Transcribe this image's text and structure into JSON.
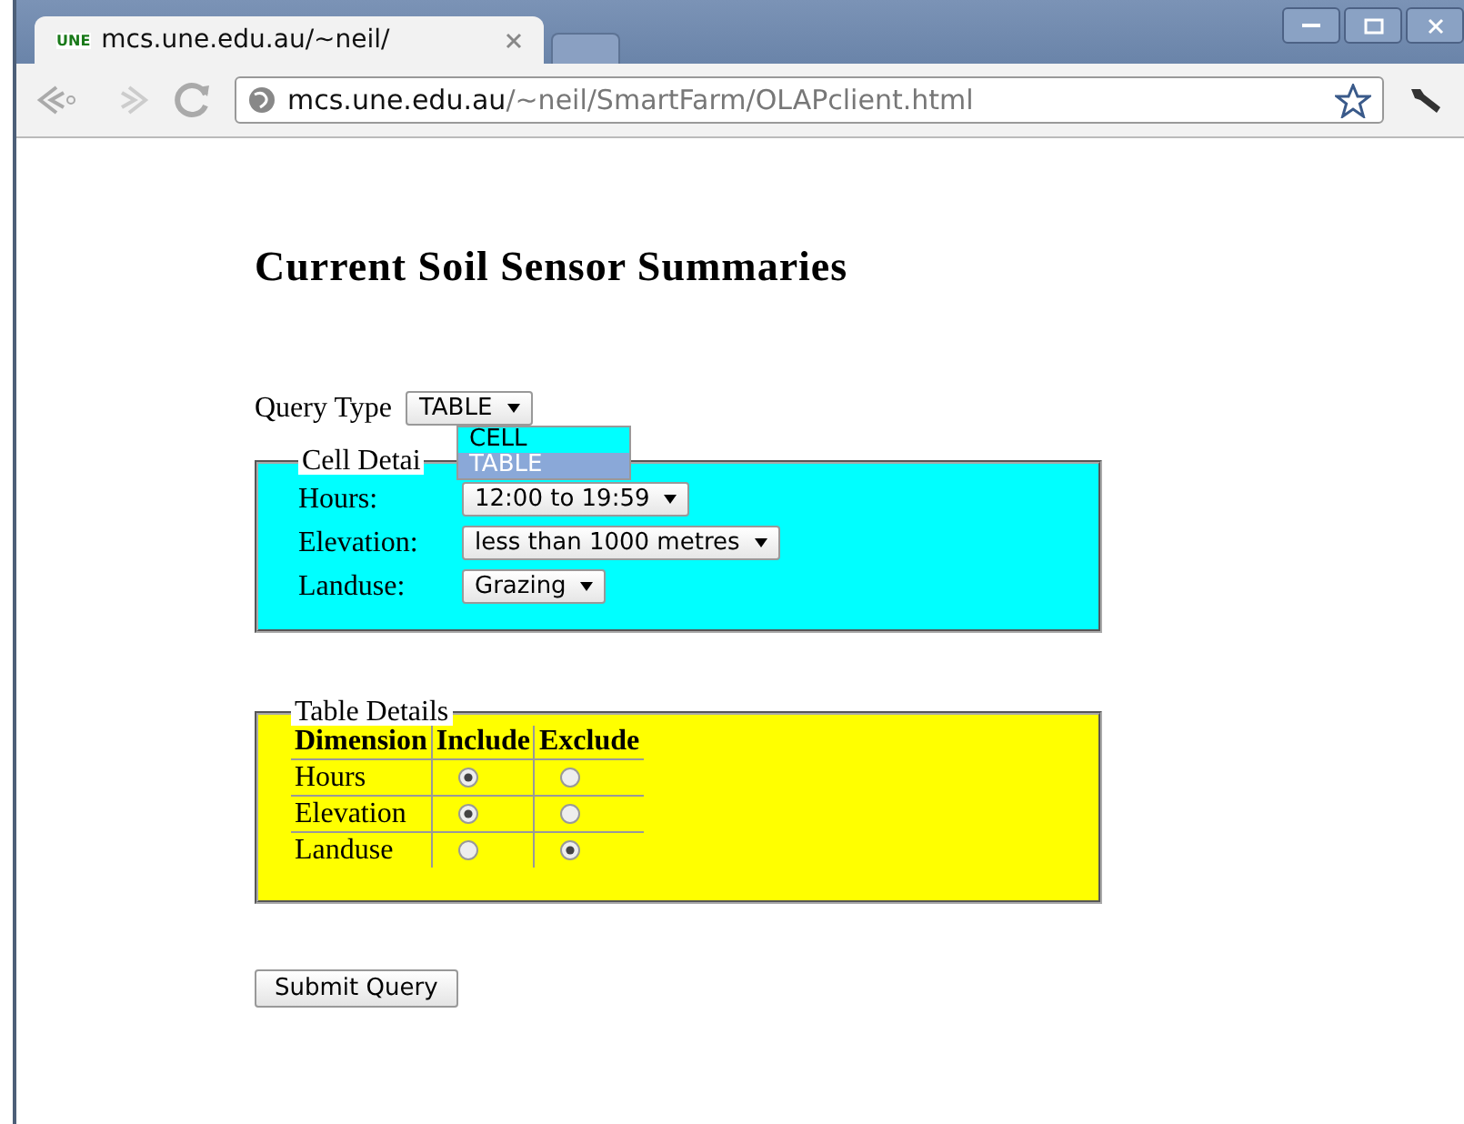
{
  "browser": {
    "tab": {
      "favicon": "UNE",
      "title": "mcs.une.edu.au/~neil/"
    },
    "address": {
      "host": "mcs.une.edu.au",
      "path": "/~neil/SmartFarm/OLAPclient.html"
    }
  },
  "page": {
    "heading": "Current Soil Sensor Summaries",
    "query_type": {
      "label": "Query Type",
      "value": "TABLE",
      "options": [
        {
          "label": "CELL",
          "selected": false
        },
        {
          "label": "TABLE",
          "selected": true
        }
      ]
    },
    "cell_details": {
      "legend": "Cell Detai",
      "fields": [
        {
          "label": "Hours:",
          "value": "12:00 to 19:59"
        },
        {
          "label": "Elevation:",
          "value": "less than 1000 metres"
        },
        {
          "label": "Landuse:",
          "value": "Grazing"
        }
      ]
    },
    "table_details": {
      "legend": "Table Details",
      "columns": [
        "Dimension",
        "Include",
        "Exclude"
      ],
      "rows": [
        {
          "dimension": "Hours",
          "include": true,
          "exclude": false
        },
        {
          "dimension": "Elevation",
          "include": true,
          "exclude": false
        },
        {
          "dimension": "Landuse",
          "include": false,
          "exclude": true
        }
      ]
    },
    "submit": "Submit Query"
  }
}
